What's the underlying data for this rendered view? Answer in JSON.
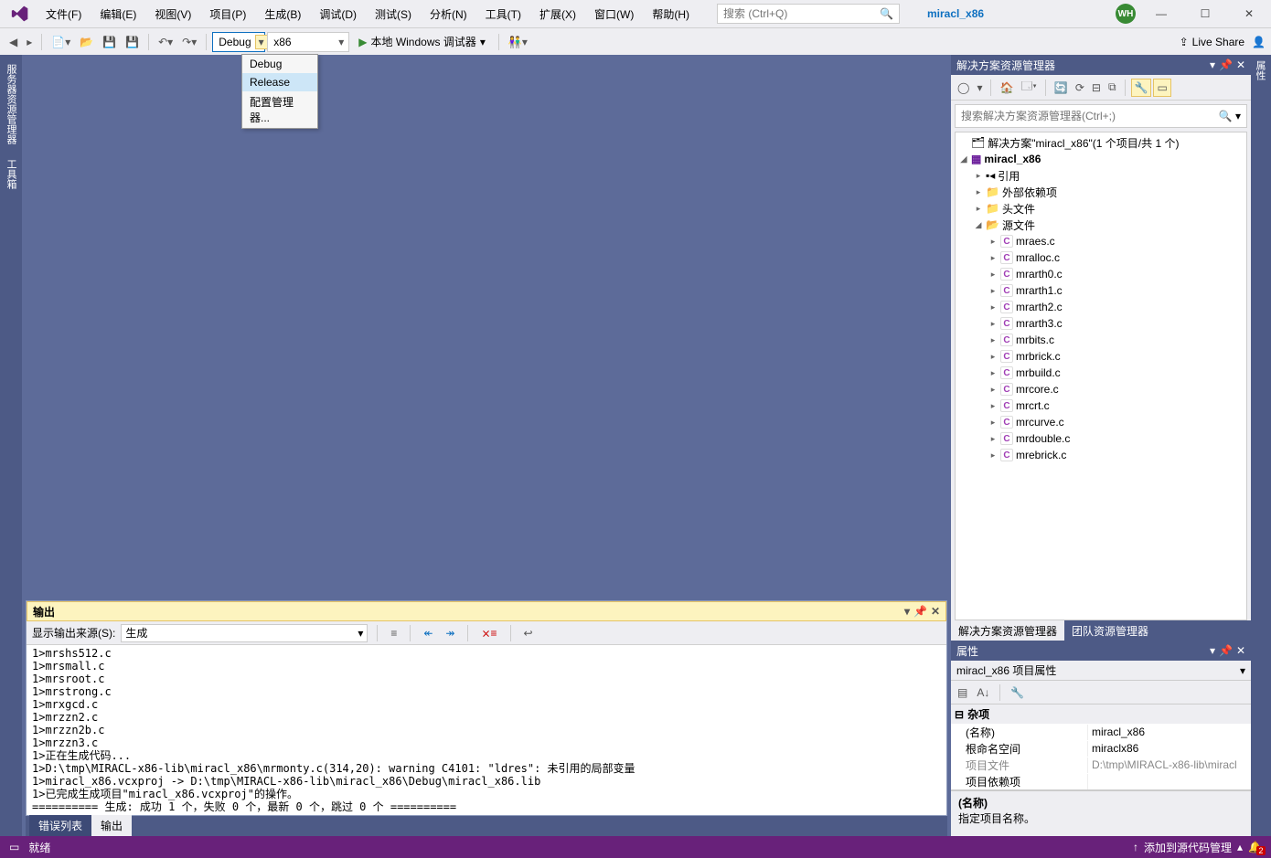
{
  "menubar": [
    "文件(F)",
    "编辑(E)",
    "视图(V)",
    "项目(P)",
    "生成(B)",
    "调试(D)",
    "测试(S)",
    "分析(N)",
    "工具(T)",
    "扩展(X)",
    "窗口(W)",
    "帮助(H)"
  ],
  "search_placeholder": "搜索 (Ctrl+Q)",
  "title_project": "miracl_x86",
  "avatar": "WH",
  "toolbar": {
    "config": "Debug",
    "platform": "x86",
    "debugger": "本地 Windows 调试器",
    "live_share": "Live Share"
  },
  "config_dropdown": [
    "Debug",
    "Release",
    "配置管理器..."
  ],
  "config_selected_idx": 1,
  "left_rail": [
    "服务器资源管理器",
    "工具箱"
  ],
  "right_rail": [
    "属性"
  ],
  "output": {
    "title": "输出",
    "source_label": "显示输出来源(S):",
    "source_value": "生成",
    "lines": [
      "1>mrshs512.c",
      "1>mrsmall.c",
      "1>mrsroot.c",
      "1>mrstrong.c",
      "1>mrxgcd.c",
      "1>mrzzn2.c",
      "1>mrzzn2b.c",
      "1>mrzzn3.c",
      "1>正在生成代码...",
      "1>D:\\tmp\\MIRACL-x86-lib\\miracl_x86\\mrmonty.c(314,20): warning C4101: \"ldres\": 未引用的局部变量",
      "1>miracl_x86.vcxproj -> D:\\tmp\\MIRACL-x86-lib\\miracl_x86\\Debug\\miracl_x86.lib",
      "1>已完成生成项目\"miracl_x86.vcxproj\"的操作。",
      "========== 生成: 成功 1 个，失败 0 个，最新 0 个，跳过 0 个 =========="
    ]
  },
  "bottom_tabs": [
    "错误列表",
    "输出"
  ],
  "bottom_tab_active": 1,
  "solution_explorer": {
    "title": "解决方案资源管理器",
    "search_placeholder": "搜索解决方案资源管理器(Ctrl+;)",
    "solution": "解决方案\"miracl_x86\"(1 个项目/共 1 个)",
    "project": "miracl_x86",
    "nodes": [
      "引用",
      "外部依赖项",
      "头文件",
      "源文件"
    ],
    "source_files": [
      "mraes.c",
      "mralloc.c",
      "mrarth0.c",
      "mrarth1.c",
      "mrarth2.c",
      "mrarth3.c",
      "mrbits.c",
      "mrbrick.c",
      "mrbuild.c",
      "mrcore.c",
      "mrcrt.c",
      "mrcurve.c",
      "mrdouble.c",
      "mrebrick.c"
    ]
  },
  "se_tabs": [
    "解决方案资源管理器",
    "团队资源管理器"
  ],
  "se_tab_active": 0,
  "properties": {
    "title": "属性",
    "object": "miracl_x86 项目属性",
    "category": "杂项",
    "rows": [
      {
        "name": "(名称)",
        "value": "miracl_x86",
        "disabled": false
      },
      {
        "name": "根命名空间",
        "value": "miraclx86",
        "disabled": false
      },
      {
        "name": "项目文件",
        "value": "D:\\tmp\\MIRACL-x86-lib\\miracl",
        "disabled": true
      },
      {
        "name": "项目依赖项",
        "value": "",
        "disabled": false
      }
    ],
    "desc_title": "(名称)",
    "desc_text": "指定项目名称。"
  },
  "statusbar": {
    "ready": "就绪",
    "scm": "添加到源代码管理",
    "notif_count": "2"
  }
}
